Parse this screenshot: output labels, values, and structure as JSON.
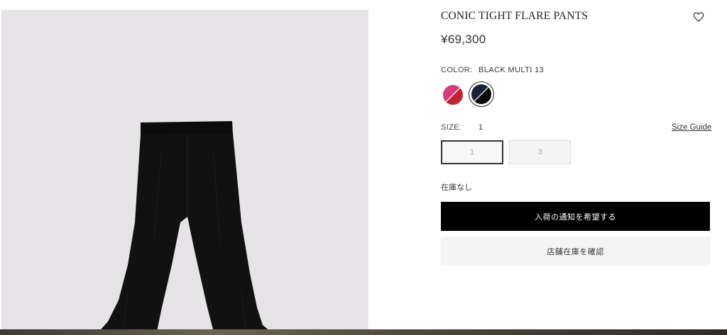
{
  "product": {
    "title": "CONIC TIGHT FLARE PANTS",
    "price": "¥69,300",
    "image_icon": "black-flare-pants-image",
    "wishlist_icon": "heart-outline-icon"
  },
  "color": {
    "label": "COLOR:",
    "selected_value": "BLACK MULTI 13",
    "swatches": [
      {
        "name": "pink-red",
        "top": "#d63a7a",
        "bottom": "#c3202f",
        "selected": false
      },
      {
        "name": "black-multi-13",
        "top": "#1b2238",
        "bottom": "#0a0a0a",
        "selected": true
      }
    ]
  },
  "size": {
    "label": "SIZE:",
    "selected_value": "1",
    "guide_label": "Size Guide",
    "options": [
      {
        "label": "1",
        "selected": true
      },
      {
        "label": "3",
        "selected": false
      }
    ]
  },
  "stock_status": "在庫なし",
  "actions": {
    "notify_label": "入荷の通知を希望する",
    "store_stock_label": "店舗在庫を確認"
  },
  "colors": {
    "primary_button_bg": "#000000",
    "secondary_button_bg": "#f4f4f4",
    "image_bg": "#e6e4e6"
  }
}
